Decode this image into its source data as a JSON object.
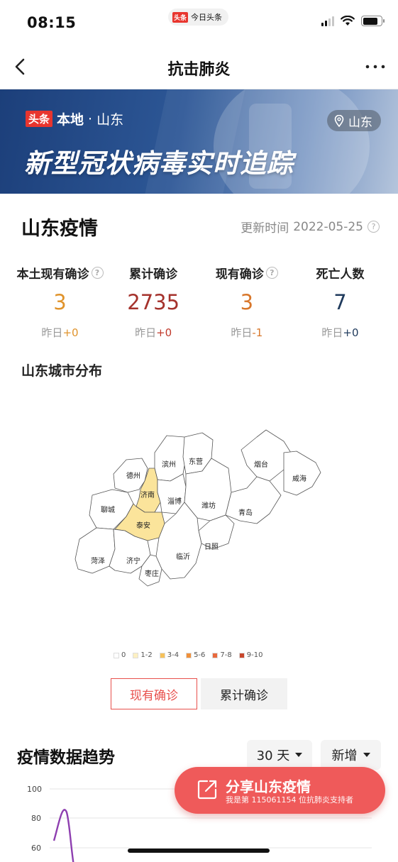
{
  "status_bar": {
    "time": "08:15",
    "app_logo": "头条",
    "app_name": "今日头条"
  },
  "nav": {
    "title": "抗击肺炎",
    "back_icon": "chevron-left-icon",
    "more_icon": "more-dots-icon"
  },
  "banner": {
    "logo": "头条",
    "local_label": "本地",
    "separator": "·",
    "region": "山东",
    "headline": "新型冠状病毒实时追踪",
    "location_chip": "山东"
  },
  "section": {
    "title": "山东疫情",
    "update_label": "更新时间",
    "update_date": "2022-05-25"
  },
  "stats": [
    {
      "label": "本土现有确诊",
      "value": "3",
      "delta_label": "昨日",
      "delta": "+0",
      "color": "#e0932b",
      "delta_color": "#e0932b",
      "has_help": true
    },
    {
      "label": "累计确诊",
      "value": "2735",
      "delta_label": "昨日",
      "delta": "+0",
      "color": "#a5322c",
      "delta_color": "#c0392b",
      "has_help": false
    },
    {
      "label": "现有确诊",
      "value": "3",
      "delta_label": "昨日",
      "delta": "-1",
      "color": "#d8772b",
      "delta_color": "#d8772b",
      "has_help": true
    },
    {
      "label": "死亡人数",
      "value": "7",
      "delta_label": "昨日",
      "delta": "+0",
      "color": "#1f3a5c",
      "delta_color": "#1f3a5c",
      "has_help": false
    }
  ],
  "map": {
    "title": "山东城市分布",
    "cities": [
      "德州",
      "滨州",
      "东营",
      "烟台",
      "威海",
      "济南",
      "淄博",
      "潍坊",
      "聊城",
      "泰安",
      "青岛",
      "日照",
      "菏泽",
      "济宁",
      "临沂",
      "枣庄"
    ],
    "highlighted": [
      "济南",
      "泰安"
    ],
    "highlight_color": "#fbe49b",
    "legend": [
      {
        "label": "0",
        "color": "#ffffff"
      },
      {
        "label": "1-2",
        "color": "#fdf0c2"
      },
      {
        "label": "3-4",
        "color": "#f6c15a"
      },
      {
        "label": "5-6",
        "color": "#f0903a"
      },
      {
        "label": "7-8",
        "color": "#e86a3e"
      },
      {
        "label": "9-10",
        "color": "#c8472d"
      }
    ]
  },
  "toggles": {
    "active": "现有确诊",
    "inactive": "累计确诊"
  },
  "trend": {
    "title": "疫情数据趋势",
    "range": "30 天",
    "mode": "新增",
    "y_ticks": [
      "100",
      "80",
      "60"
    ],
    "line_color": "#8e3fb0"
  },
  "share": {
    "title": "分享山东疫情",
    "subtitle": "我是第 115061154 位抗肺炎支持者",
    "icon": "share-icon"
  },
  "colors": {
    "accent": "#e8504c",
    "brand": "#e8352e"
  }
}
